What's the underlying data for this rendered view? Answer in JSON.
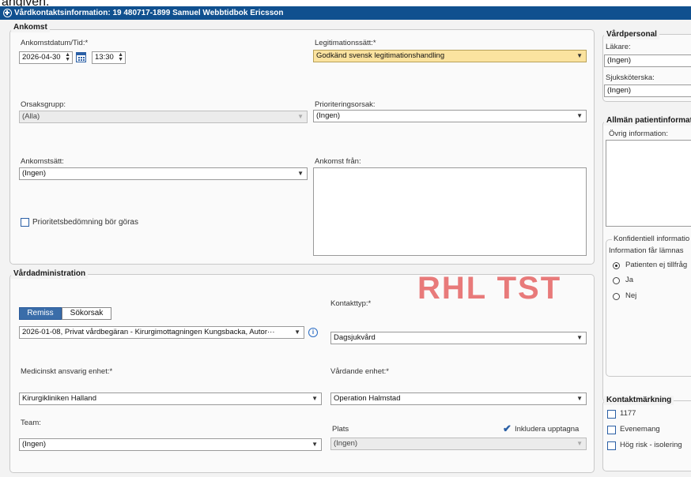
{
  "window": {
    "top_fragment": "angiven.",
    "title": "Vårdkontaktsinformation: 19 480717-1899 Samuel Webbtidbok Ericsson"
  },
  "ankomst": {
    "title": "Ankomst",
    "datetime_label": "Ankomstdatum/Tid:*",
    "date_value": "2026-04-30",
    "time_value": "13:30",
    "legitimation_label": "Legitimationssätt:*",
    "legitimation_value": "Godkänd svensk legitimationshandling",
    "orsaksgrupp_label": "Orsaksgrupp:",
    "orsaksgrupp_value": "(Alla)",
    "prioriteringsorsak_label": "Prioriteringsorsak:",
    "prioriteringsorsak_value": "(Ingen)",
    "ankomstsatt_label": "Ankomstsätt:",
    "ankomstsatt_value": "(Ingen)",
    "ankomst_fran_label": "Ankomst från:",
    "prioritet_checkbox_label": "Prioritetsbedömning bör göras"
  },
  "vardadmin": {
    "title": "Vårdadministration",
    "watermark": "RHL TST",
    "tabs": [
      "Remiss",
      "Sökorsak"
    ],
    "remiss_value": "2026-01-08, Privat vårdbegäran  - Kirurgimottagningen Kungsbacka, Autor···",
    "kontakttyp_label": "Kontakttyp:*",
    "kontakttyp_value": "Dagsjukvård",
    "med_ansvarig_label": "Medicinskt ansvarig enhet:*",
    "med_ansvarig_value": "Kirurgikliniken Halland",
    "vardande_label": "Vårdande enhet:*",
    "vardande_value": "Operation Halmstad",
    "team_label": "Team:",
    "team_value": "(Ingen)",
    "plats_label": "Plats",
    "plats_value": "(Ingen)",
    "inkludera_label": "Inkludera upptagna"
  },
  "vardpersonal": {
    "title": "Vårdpersonal",
    "lakare_label": "Läkare:",
    "lakare_value": "(Ingen)",
    "sjukskoterska_label": "Sjuksköterska:",
    "sjukskoterska_value": "(Ingen)"
  },
  "allman": {
    "title": "Allmän patientinformat",
    "ovrig_label": "Övrig information:",
    "konfidentiell_title": "Konfidentiell informatio",
    "information_label": "Information får lämnas",
    "options": [
      "Patienten ej tillfråg",
      "Ja",
      "Nej"
    ]
  },
  "kontaktmarkning": {
    "title": "Kontaktmärkning",
    "items": [
      "1177",
      "Evenemang",
      "Hög risk - isolering"
    ]
  },
  "icons": {
    "calendar": "calendar-icon",
    "info": "info-icon",
    "check": "checkmark-icon",
    "window": "plus-circle-icon"
  }
}
